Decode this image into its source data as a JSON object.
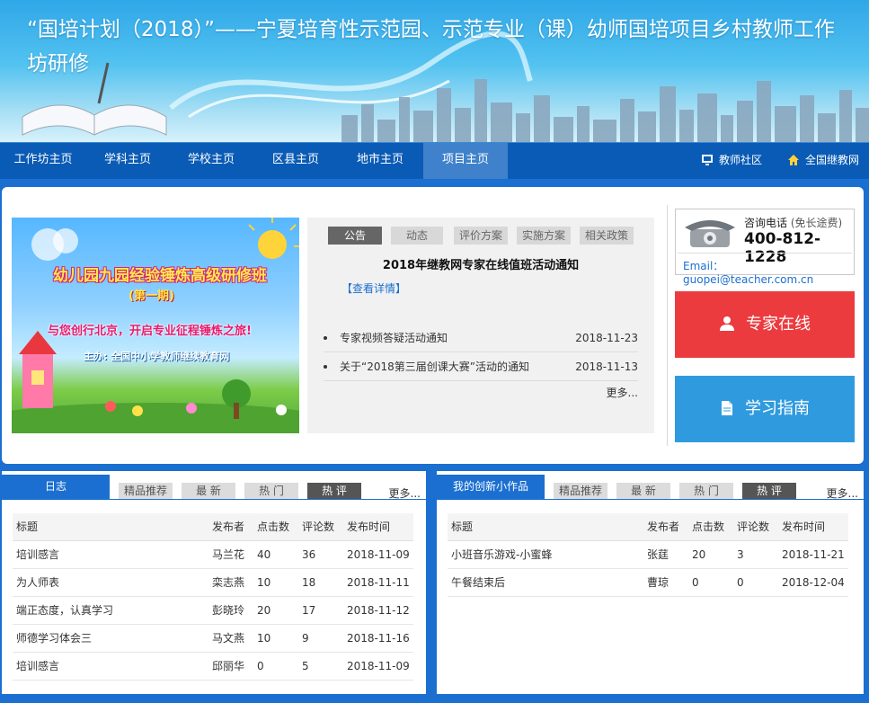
{
  "banner": {
    "title": "“国培计划（2018）”——宁夏培育性示范园、示范专业（课）幼师国培项目乡村教师工作坊研修"
  },
  "nav": {
    "items": [
      "工作坊主页",
      "学科主页",
      "学校主页",
      "区县主页",
      "地市主页",
      "项目主页"
    ],
    "active_index": 5,
    "teacher_community": "教师社区",
    "national_site": "全国继教网"
  },
  "slide": {
    "title": "幼儿园九园经验锤炼高级研修班",
    "subtitle": "(第一期)",
    "slogan": "与您创行北京，开启专业征程锤炼之旅!",
    "host": "主办: 全国中小学教师继续教育网"
  },
  "notice": {
    "tabs": [
      "公告",
      "动态",
      "评价方案",
      "实施方案",
      "相关政策"
    ],
    "active_tab": 0,
    "headline": "2018年继教网专家在线值班活动通知",
    "detail_link": "【查看详情】",
    "items": [
      {
        "title": "专家视频答疑活动通知",
        "date": "2018-11-23"
      },
      {
        "title": "关于“2018第三届创课大赛”活动的通知",
        "date": "2018-11-13"
      }
    ],
    "more": "更多..."
  },
  "contact": {
    "label": "咨询电话",
    "free_note": "(免长途费)",
    "phone": "400-812-1228",
    "email": "Email：guopei@teacher.com.cn"
  },
  "buttons": {
    "expert": "专家在线",
    "guide": "学习指南"
  },
  "blog": {
    "title": "日志",
    "tabs": [
      "精品推荐",
      "最 新",
      "热 门",
      "热 评"
    ],
    "active_tab": 3,
    "more": "更多...",
    "columns": [
      "标题",
      "发布者",
      "点击数",
      "评论数",
      "发布时间"
    ],
    "rows": [
      [
        "培训感言",
        "马兰花",
        "40",
        "36",
        "2018-11-09"
      ],
      [
        "为人师表",
        "栾志燕",
        "10",
        "18",
        "2018-11-11"
      ],
      [
        "端正态度，认真学习",
        "彭晓玲",
        "20",
        "17",
        "2018-11-12"
      ],
      [
        "师德学习体会三",
        "马文燕",
        "10",
        "9",
        "2018-11-16"
      ],
      [
        "培训感言",
        "邱丽华",
        "0",
        "5",
        "2018-11-09"
      ]
    ]
  },
  "works": {
    "title": "我的创新小作品",
    "tabs": [
      "精品推荐",
      "最 新",
      "热 门",
      "热 评"
    ],
    "active_tab": 3,
    "more": "更多...",
    "columns": [
      "标题",
      "发布者",
      "点击数",
      "评论数",
      "发布时间"
    ],
    "rows": [
      [
        "小班音乐游戏-小蜜蜂",
        "张莛",
        "20",
        "3",
        "2018-11-21"
      ],
      [
        "午餐结束后",
        "曹琼",
        "0",
        "0",
        "2018-12-04"
      ]
    ]
  },
  "colors": {
    "nav_bg": "#0a5bb5",
    "accent_blue": "#1b6fd0",
    "expert_red": "#ec3b3f",
    "guide_blue": "#2f9bde"
  }
}
